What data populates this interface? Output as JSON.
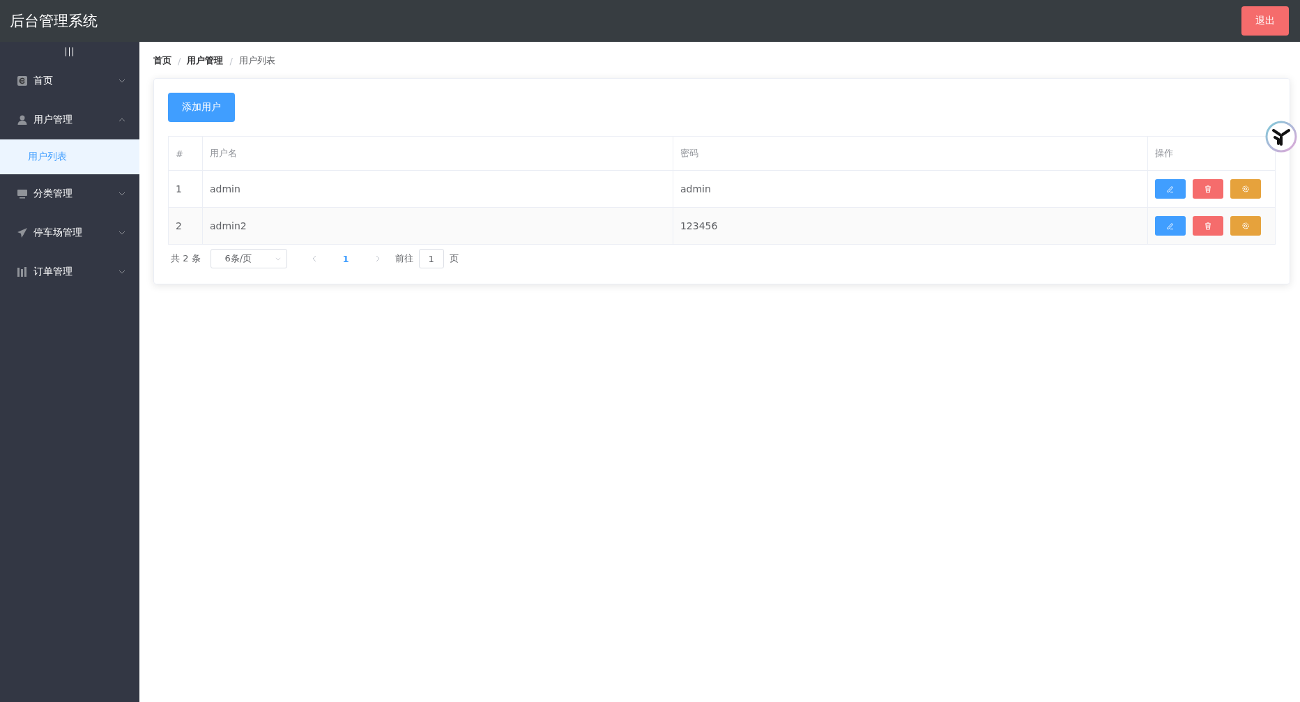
{
  "header": {
    "title": "后台管理系统",
    "logout_button": "退出"
  },
  "sidebar": {
    "toggle": "|||",
    "items": [
      {
        "label": "首页",
        "expanded": false
      },
      {
        "label": "用户管理",
        "expanded": true,
        "children": [
          {
            "label": "用户列表",
            "selected": true
          }
        ]
      },
      {
        "label": "分类管理",
        "expanded": false
      },
      {
        "label": "停车场管理",
        "expanded": false
      },
      {
        "label": "订单管理",
        "expanded": false
      }
    ]
  },
  "breadcrumb": {
    "separator": "/",
    "items": [
      "首页",
      "用户管理",
      "用户列表"
    ]
  },
  "add_button": "添加用户",
  "table": {
    "columns": [
      "#",
      "用户名",
      "密码",
      "操作"
    ],
    "rows": [
      {
        "index": "1",
        "username": "admin",
        "password": "admin"
      },
      {
        "index": "2",
        "username": "admin2",
        "password": "123456"
      }
    ]
  },
  "pagination": {
    "total": "共 2 条",
    "page_size": "6条/页",
    "pages": [
      {
        "label": "1",
        "selected": true
      }
    ],
    "goto_label": "前往",
    "goto_value": "1",
    "goto_suffix": "页"
  }
}
